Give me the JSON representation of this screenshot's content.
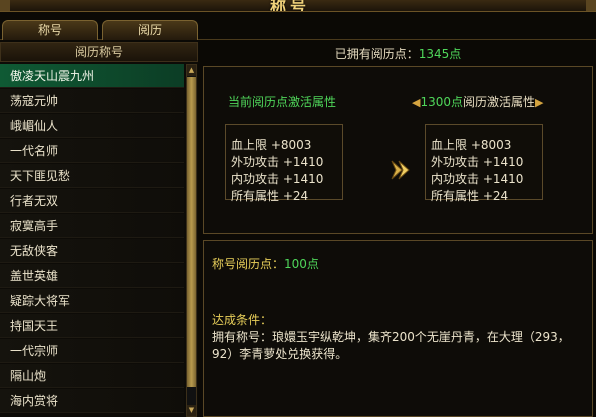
{
  "window": {
    "title": "称号"
  },
  "tabs": [
    {
      "label": "称号"
    },
    {
      "label": "阅历"
    }
  ],
  "list": {
    "header": "阅历称号",
    "items": [
      "傲凌天山震九州",
      "荡寇元帅",
      "峨嵋仙人",
      "一代名师",
      "天下匪见愁",
      "行者无双",
      "寂寞高手",
      "无敌侠客",
      "盖世英雄",
      "疑踪大将军",
      "持国天王",
      "一代宗师",
      "隔山炮",
      "海内赏将"
    ],
    "selected_index": 0
  },
  "owned": {
    "label": "已拥有阅历点：",
    "value": "1345点"
  },
  "current": {
    "title": "当前阅历点激活属性",
    "attrs": [
      "血上限 +8003",
      "外功攻击 +1410",
      "内功攻击 +1410",
      "所有属性 +24"
    ]
  },
  "next": {
    "points": "1300点",
    "title": "阅历激活属性",
    "attrs": [
      "血上限 +8003",
      "外功攻击 +1410",
      "内功攻击 +1410",
      "所有属性 +24"
    ]
  },
  "detail": {
    "points_label": "称号阅历点：",
    "points_value": "100点",
    "condition_label": "达成条件：",
    "condition_text": "拥有称号：琅嬛玉宇纵乾坤，集齐200个无崖丹青，在大理（293，92）李青萝处兑换获得。"
  },
  "colors": {
    "accent_green": "#4fd65a",
    "gold": "#e8cf5a",
    "selected_row": "#0f5a34"
  }
}
